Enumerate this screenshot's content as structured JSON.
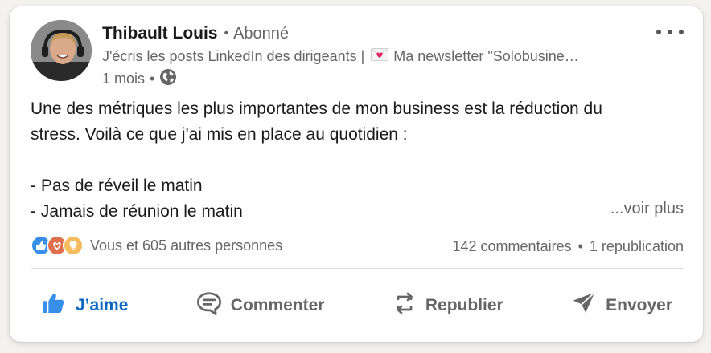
{
  "author": {
    "name": "Thibault Louis",
    "follow_status": "Abonné",
    "headline_prefix": "J'écris les posts LinkedIn des dirigeants |",
    "headline_suffix": "Ma newsletter \"Solobusine…",
    "time": "1 mois",
    "visibility_icon": "globe-icon"
  },
  "post": {
    "paragraph_1_line_1": "Une des métriques les plus importantes de mon business est la réduction du",
    "paragraph_1_line_2": "stress. Voilà ce que j'ai mis en place au quotidien :",
    "bullet_1": "- Pas de réveil le matin",
    "bullet_2": "- Jamais de réunion le matin",
    "see_more": "...voir plus"
  },
  "social": {
    "reaction_icons": [
      "like-icon",
      "love-icon",
      "insightful-icon"
    ],
    "reactions_text": "Vous et 605 autres personnes",
    "comments_text": "142 commentaires",
    "reposts_text": "1 republication"
  },
  "actions": {
    "like": "J’aime",
    "comment": "Commenter",
    "repost": "Republier",
    "send": "Envoyer"
  },
  "colors": {
    "accent": "#0a66c2",
    "secondary_text": "#666666",
    "like_reaction": "#378fe9",
    "love_reaction": "#df704d",
    "insightful_reaction": "#f5bb5c"
  }
}
